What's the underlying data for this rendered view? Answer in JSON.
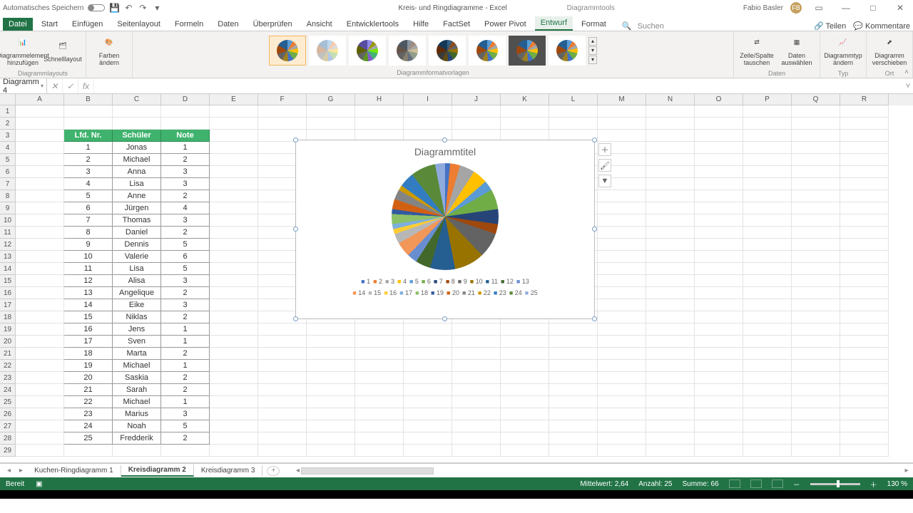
{
  "titlebar": {
    "autosave": "Automatisches Speichern",
    "title": "Kreis- und Ringdiagramme  -  Excel",
    "tools": "Diagrammtools",
    "user": "Fabio Basler",
    "badge": "FB"
  },
  "tabs": {
    "file": "Datei",
    "items": [
      "Start",
      "Einfügen",
      "Seitenlayout",
      "Formeln",
      "Daten",
      "Überprüfen",
      "Ansicht",
      "Entwicklertools",
      "Hilfe",
      "FactSet",
      "Power Pivot",
      "Entwurf",
      "Format"
    ],
    "search": "Suchen",
    "share": "Teilen",
    "comments": "Kommentare"
  },
  "ribbon": {
    "add_element": "Diagrammelement hinzufügen",
    "quick_layout": "Schnelllayout",
    "change_colors": "Farben ändern",
    "switch_rowcol": "Zeile/Spalte tauschen",
    "select_data": "Daten auswählen",
    "change_type": "Diagrammtyp ändern",
    "move_chart": "Diagramm verschieben",
    "group_layouts": "Diagrammlayouts",
    "group_styles": "Diagrammformatvorlagen",
    "group_data": "Daten",
    "group_type": "Typ",
    "group_location": "Ort"
  },
  "namebox": "Diagramm 4",
  "table": {
    "headers": [
      "Lfd. Nr.",
      "Schüler",
      "Note"
    ],
    "rows": [
      [
        "1",
        "Jonas",
        "1"
      ],
      [
        "2",
        "Michael",
        "2"
      ],
      [
        "3",
        "Anna",
        "3"
      ],
      [
        "4",
        "Lisa",
        "3"
      ],
      [
        "5",
        "Anne",
        "2"
      ],
      [
        "6",
        "Jürgen",
        "4"
      ],
      [
        "7",
        "Thomas",
        "3"
      ],
      [
        "8",
        "Daniel",
        "2"
      ],
      [
        "9",
        "Dennis",
        "5"
      ],
      [
        "10",
        "Valerie",
        "6"
      ],
      [
        "11",
        "Lisa",
        "5"
      ],
      [
        "12",
        "Alisa",
        "3"
      ],
      [
        "13",
        "Angelique",
        "2"
      ],
      [
        "14",
        "Eike",
        "3"
      ],
      [
        "15",
        "Niklas",
        "2"
      ],
      [
        "16",
        "Jens",
        "1"
      ],
      [
        "17",
        "Sven",
        "1"
      ],
      [
        "18",
        "Marta",
        "2"
      ],
      [
        "19",
        "Michael",
        "1"
      ],
      [
        "20",
        "Saskia",
        "2"
      ],
      [
        "21",
        "Sarah",
        "2"
      ],
      [
        "22",
        "Michael",
        "1"
      ],
      [
        "23",
        "Marius",
        "3"
      ],
      [
        "24",
        "Noah",
        "5"
      ],
      [
        "25",
        "Fredderik",
        "2"
      ]
    ]
  },
  "chart": {
    "title": "Diagrammtitel"
  },
  "chart_data": {
    "type": "pie",
    "title": "Diagrammtitel",
    "categories": [
      "1",
      "2",
      "3",
      "4",
      "5",
      "6",
      "7",
      "8",
      "9",
      "10",
      "11",
      "12",
      "13",
      "14",
      "15",
      "16",
      "17",
      "18",
      "19",
      "20",
      "21",
      "22",
      "23",
      "24",
      "25"
    ],
    "values": [
      1,
      2,
      3,
      3,
      2,
      4,
      3,
      2,
      5,
      6,
      5,
      3,
      2,
      3,
      2,
      1,
      1,
      2,
      1,
      2,
      2,
      1,
      3,
      5,
      2
    ],
    "legend_position": "bottom"
  },
  "sheets": {
    "tabs": [
      "Kuchen-Ringdiagramm 1",
      "Kreisdiagramm 2",
      "Kreisdiagramm 3"
    ],
    "active": 1
  },
  "status": {
    "ready": "Bereit",
    "avg_label": "Mittelwert:",
    "avg": "2,64",
    "count_label": "Anzahl:",
    "count": "25",
    "sum_label": "Summe:",
    "sum": "66",
    "zoom": "130 %"
  },
  "columns": [
    "A",
    "B",
    "C",
    "D",
    "E",
    "F",
    "G",
    "H",
    "I",
    "J",
    "K",
    "L",
    "M",
    "N",
    "O",
    "P",
    "Q",
    "R"
  ]
}
